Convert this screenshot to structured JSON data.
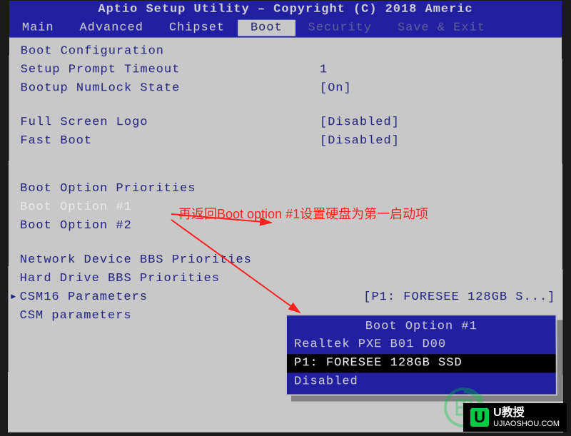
{
  "header": {
    "title": "Aptio Setup Utility – Copyright (C) 2018 Americ"
  },
  "tabs": [
    "Main",
    "Advanced",
    "Chipset",
    "Boot",
    "Security",
    "Save & Exit"
  ],
  "active_tab": "Boot",
  "content": {
    "section": "Boot Configuration",
    "items": [
      {
        "label": "Setup Prompt Timeout",
        "value": "1"
      },
      {
        "label": "Bootup NumLock State",
        "value": "[On]"
      }
    ],
    "items2": [
      {
        "label": "Full Screen Logo",
        "value": "[Disabled]"
      },
      {
        "label": "Fast Boot",
        "value": "[Disabled]"
      }
    ],
    "priorities_section": "Boot Option Priorities",
    "boot_option_1": "Boot Option #1",
    "boot_option_2": "Boot Option #2",
    "hint": "[P1: FORESEE 128GB S...]",
    "submenus": [
      "Network Device BBS Priorities",
      "Hard Drive BBS Priorities",
      "CSM16 Parameters",
      "CSM parameters"
    ]
  },
  "popup": {
    "title": "Boot Option #1",
    "options": [
      "Realtek PXE B01 D00",
      "P1: FORESEE 128GB SSD",
      "Disabled"
    ],
    "selected_index": 1
  },
  "annotation": {
    "text": "再返回Boot option #1设置硬盘为第一启动项"
  },
  "watermark": {
    "brand": "U教授",
    "url": "UJIAOSHOU.COM"
  }
}
